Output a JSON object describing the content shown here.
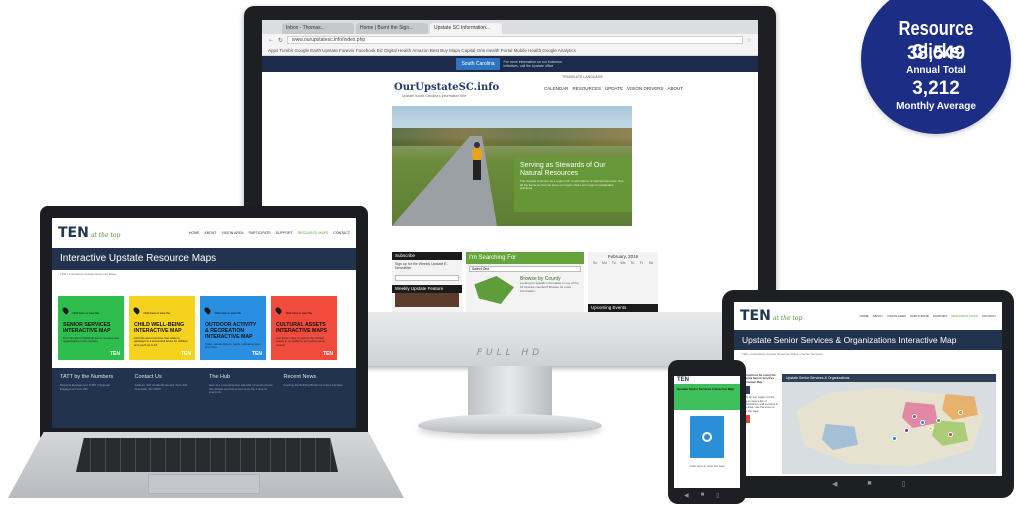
{
  "badge": {
    "title": "Resource Clicks",
    "annual_value": "38,549",
    "annual_label": "Annual Total",
    "monthly_value": "3,212",
    "monthly_label": "Monthly Average",
    "color": "#1c2d86"
  },
  "monitor": {
    "brand_text": "FULL HD",
    "browser": {
      "tabs": [
        "Inbox - Thomas...",
        "Home | Burnt the Sign...",
        "Upstate SC Information..."
      ],
      "address": "www.ourupstatesc.info/index.php",
      "bookmarks": "Apps   Tumblr   Google Earth   Upstate Forever   Facebook   Biz   Digital Health   Amazon   Best Buy   Maps   Capital One   Health Portal   Mobile Health   Google Analytics"
    },
    "site": {
      "sponsor": "South Carolina",
      "sponsor_msg": "For more information on our business initiatives, call the Upstate office",
      "logo": "OurUpstateSC.info",
      "tagline": "Upstate South Carolina's Information Site",
      "translate": "TRANSLATE LANGUAGE",
      "nav": [
        "CALENDAR",
        "RESOURCES",
        "UPDATE",
        "VISION DRIVERS",
        "ABOUT"
      ],
      "hero_title": "Serving as Stewards of Our Natural Resources",
      "hero_text": "The Upstate is known as a region rich in abundance of natural resources. See all the items on how we keep our region clean and support sustainable practices.",
      "subscribe_title": "Subscribe",
      "subscribe_text": "Sign up for the Weekly Upstate E-Newsletter",
      "weekly_feature": "Weekly Upstate Feature",
      "searching_title": "I'm Searching For",
      "searching_select": "Select One",
      "browse_title": "Browse by County",
      "browse_text": "Looking for specific information in one of the 10 Upstate counties? Browse for more information.",
      "calendar_month": "February, 2016",
      "calendar_days": [
        "Su",
        "Mo",
        "Tu",
        "We",
        "Th",
        "Fr",
        "Sa"
      ],
      "upcoming": "Upcoming Events",
      "hero_colors": {
        "caption": "#669838",
        "rider": "#e8a21d"
      }
    }
  },
  "laptop": {
    "logo_big": "TEN",
    "logo_small": "at the top",
    "nav": [
      "HOME",
      "ABOUT",
      "VISION AREA",
      "PARTICIPATE",
      "SUPPORT",
      "RESOURCE MAPS",
      "CONTACT"
    ],
    "banner": "Interactive Upstate Resource Maps",
    "crumb": "TEN » Interactive Upstate Resource Maps",
    "tiles": [
      {
        "kicker": "Click here to view the",
        "title": "SENIOR SERVICES INTERACTIVE MAP",
        "desc": "Find info about individual senior services and organizations in the Upstate.",
        "mark": "TEN",
        "color": "#2fbe4d"
      },
      {
        "kicker": "Click here to view the",
        "title": "CHILD WELL-BEING INTERACTIVE MAP",
        "desc": "Find info about services that relate to pathways to a successful future for children and youth up to 16.",
        "mark": "TEN",
        "color": "#f4d21e"
      },
      {
        "kicker": "Click here to view the",
        "title": "OUTDOOR ACTIVITY & RECREATION INTERACTIVE MAP",
        "desc": "Trails, natural spaces, parks, recreation sites and more.",
        "mark": "TEN",
        "color": "#2a8fe0"
      },
      {
        "kicker": "Click here to view the",
        "title": "CULTURAL ASSETS INTERACTIVE MAPS",
        "desc": "Use these maps to explore the cultural assets in our galleries and performance venues.",
        "mark": "TEN",
        "color": "#f04b3d"
      }
    ],
    "footer": [
      {
        "heading": "TATT by the Numbers",
        "text": "Regional Engagement: 8,987 | Regional Engagement from 200"
      },
      {
        "heading": "Contact Us",
        "text": "Address: 124 Verdae Boulevard, Suite 403, Greenville, SC 29607"
      },
      {
        "heading": "The Hub",
        "text": "Here is a comprehensive calendar of events across the Upstate and has proven to be the 1 stop for event info."
      },
      {
        "heading": "Recent News",
        "text": "Inspiring the Building Blocks for Future Families"
      }
    ]
  },
  "tablet": {
    "logo_big": "TEN",
    "logo_small": "at the top",
    "nav": [
      "HOME",
      "ABOUT",
      "VISION AREA",
      "PARTICIPATE",
      "SUPPORT",
      "RESOURCE MAPS",
      "CONTACT"
    ],
    "banner": "Upstate Senior Services & Organizations Interactive Map",
    "crumb": "TEN » Interactive Upstate Resource Maps » Senior Services",
    "side_title": "Instructions for using the Upstate Senior Services Interactive Map",
    "side_text": "Click on any region on the map to view a list of organizations and services in that area. Use the icons to filter the view.",
    "map_title": "Upstate Senior Services & Organizations"
  },
  "phone": {
    "label": "Upstate Senior Services Interactive Map",
    "sub": "Click here to view the map"
  }
}
